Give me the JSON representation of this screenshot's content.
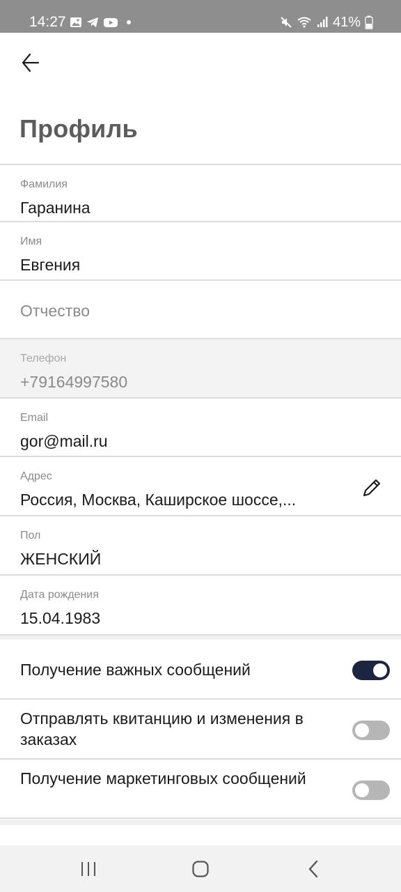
{
  "status_bar": {
    "time": "14:27",
    "battery": "41%",
    "left_icons": [
      "gallery-icon",
      "telegram-icon",
      "youtube-icon",
      "dot-icon"
    ],
    "right_icons": [
      "mute-icon",
      "wifi-icon",
      "signal-icon",
      "battery-icon"
    ]
  },
  "header": {
    "title": "Профиль"
  },
  "fields": {
    "last_name": {
      "label": "Фамилия",
      "value": "Гаранина"
    },
    "first_name": {
      "label": "Имя",
      "value": "Евгения"
    },
    "middle_name": {
      "placeholder": "Отчество"
    },
    "phone": {
      "label": "Телефон",
      "value": "+79164997580"
    },
    "email": {
      "label": "Email",
      "value": "gor@mail.ru"
    },
    "address": {
      "label": "Адрес",
      "value": "Россия, Москва, Каширское шоссе,..."
    },
    "gender": {
      "label": "Пол",
      "value": "ЖЕНСКИЙ"
    },
    "birth_date": {
      "label": "Дата рождения",
      "value": "15.04.1983"
    }
  },
  "toggles": {
    "important_messages": {
      "label": "Получение важных сообщений",
      "enabled": true
    },
    "receipt_changes": {
      "label": "Отправлять квитанцию и изменения в заказах",
      "enabled": false
    },
    "marketing_messages": {
      "label": "Получение маркетинговых сообщений",
      "enabled": false
    }
  },
  "colors": {
    "toggle_on": "#1c2540",
    "toggle_off": "#b6b6b6",
    "status_bar": "#8e8e8e"
  }
}
